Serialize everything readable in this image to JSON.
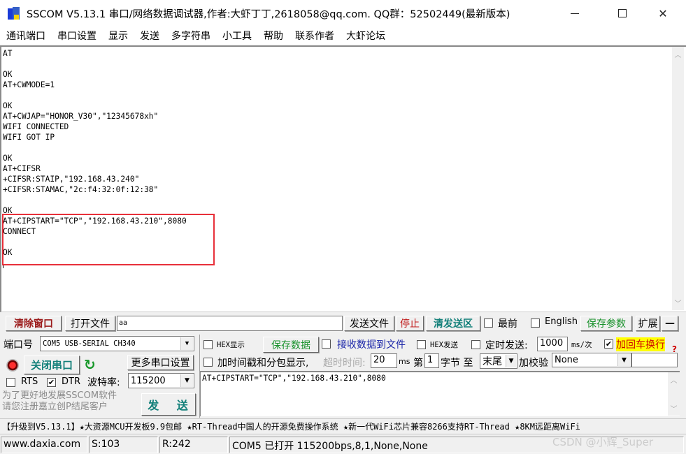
{
  "titlebar": {
    "title": "SSCOM V5.13.1 串口/网络数据调试器,作者:大虾丁丁,2618058@qq.com. QQ群：52502449(最新版本)",
    "minimize": "minimize",
    "maximize": "maximize",
    "close": "✕"
  },
  "menu": {
    "items": [
      "通讯端口",
      "串口设置",
      "显示",
      "发送",
      "多字符串",
      "小工具",
      "帮助",
      "联系作者",
      "大虾论坛"
    ]
  },
  "receive": {
    "text": "AT\n\nOK\nAT+CWMODE=1\n\nOK\nAT+CWJAP=\"HONOR_V30\",\"12345678xh\"\nWIFI CONNECTED\nWIFI GOT IP\n\nOK\nAT+CIFSR\n+CIFSR:STAIP,\"192.168.43.240\"\n+CIFSR:STAMAC,\"2c:f4:32:0f:12:38\"\n\nOK\nAT+CIPSTART=\"TCP\",\"192.168.43.210\",8080\nCONNECT\n\nOK\n",
    "highlight_color": "#e8303a"
  },
  "toolbar": {
    "clear_window": "清除窗口",
    "open_file": "打开文件",
    "file_path": "aa",
    "send_file": "发送文件",
    "stop": "停止",
    "clear_send": "清发送区",
    "topmost_label": "最前",
    "topmost_checked": false,
    "english_label": "English",
    "english_checked": false,
    "save_params": "保存参数",
    "expand": "扩展",
    "collapse": "—"
  },
  "port": {
    "port_label": "端口号",
    "port_value": "COM5 USB-SERIAL CH340",
    "close_port": "关闭串口",
    "more_settings": "更多串口设置",
    "rts_label": "RTS",
    "rts_checked": false,
    "dtr_label": "DTR",
    "dtr_checked": true,
    "baud_label": "波特率:",
    "baud_value": "115200",
    "promo_line1": "为了更好地发展SSCOM软件",
    "promo_line2": "请您注册嘉立创P结尾客户",
    "send": "发 送"
  },
  "options": {
    "hex_display": "HEX显示",
    "hex_display_checked": false,
    "save_data": "保存数据",
    "recv_to_file": "接收数据到文件",
    "recv_to_file_checked": false,
    "hex_send": "HEX发送",
    "hex_send_checked": false,
    "timed_send": "定时发送:",
    "timed_send_checked": false,
    "interval": "1000",
    "interval_unit": "ms/次",
    "add_crlf": "加回车换行",
    "add_crlf_checked": true,
    "help": "?",
    "timestamp": "加时间戳和分包显示,",
    "timestamp_checked": false,
    "timeout_label": "超时时间:",
    "timeout_value": "20",
    "timeout_unit": "ms",
    "byte_from_label": "第",
    "byte_from": "1",
    "byte_label": "字节 至",
    "byte_to": "末尾",
    "checksum_label": "加校验",
    "checksum_value": "None"
  },
  "send_area": {
    "text": "AT+CIPSTART=\"TCP\",\"192.168.43.210\",8080"
  },
  "marquee": {
    "text": "【升级到V5.13.1】★大资源MCU开发板9.9包邮 ★RT-Thread中国人的开源免费操作系统 ★新一代WiFi芯片兼容8266支持RT-Thread ★8KM远距离WiFi"
  },
  "status": {
    "website": "www.daxia.com",
    "sent": "S:103",
    "received": "R:242",
    "port_status": "COM5 已打开  115200bps,8,1,None,None"
  },
  "watermark": "CSDN @小辉_Super"
}
